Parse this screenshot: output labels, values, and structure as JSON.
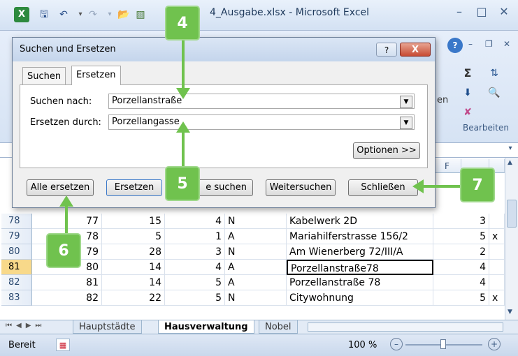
{
  "window": {
    "title": "4_Ausgabe.xlsx - Microsoft Excel"
  },
  "ribbon": {
    "group_label": "Bearbeiten",
    "partial_label": "en"
  },
  "columns": {
    "f_header": "F"
  },
  "sheet_rows": [
    {
      "row": "78",
      "b": "77",
      "c": "15",
      "d": "4",
      "e": "N",
      "f": "Kabelwerk 2D",
      "g": "3",
      "h": "",
      "active": false
    },
    {
      "row": "79",
      "b": "78",
      "c": "5",
      "d": "1",
      "e": "A",
      "f": "Mariahilferstrasse 156/2",
      "g": "5",
      "h": "x",
      "active": false
    },
    {
      "row": "80",
      "b": "79",
      "c": "28",
      "d": "3",
      "e": "N",
      "f": "Am Wienerberg 72/III/A",
      "g": "2",
      "h": "",
      "active": false
    },
    {
      "row": "81",
      "b": "80",
      "c": "14",
      "d": "4",
      "e": "A",
      "f": "Porzellanstraße78",
      "g": "4",
      "h": "",
      "active": true
    },
    {
      "row": "82",
      "b": "81",
      "c": "14",
      "d": "5",
      "e": "A",
      "f": "Porzellanstraße 78",
      "g": "4",
      "h": "",
      "active": false
    },
    {
      "row": "83",
      "b": "82",
      "c": "22",
      "d": "5",
      "e": "N",
      "f": "Citywohnung",
      "g": "5",
      "h": "x",
      "active": false
    }
  ],
  "sheet_tabs": [
    {
      "label": "Hauptstädte",
      "active": false
    },
    {
      "label": "Hausverwaltung",
      "active": true
    },
    {
      "label": "Nobel",
      "active": false
    }
  ],
  "statusbar": {
    "status": "Bereit",
    "zoom": "100 %"
  },
  "dialog": {
    "title": "Suchen und Ersetzen",
    "help_label": "?",
    "close_label": "X",
    "tabs": [
      {
        "label": "Suchen",
        "active": false
      },
      {
        "label": "Ersetzen",
        "active": true
      }
    ],
    "find_label": "Suchen nach:",
    "find_value": "Porzellanstraße",
    "replace_label": "Ersetzen durch:",
    "replace_value": "Porzellangasse",
    "options_label": "Optionen >>",
    "buttons": {
      "replace_all": "Alle ersetzen",
      "replace": "Ersetzen",
      "find_all": "e suchen",
      "find_next": "Weitersuchen",
      "close": "Schließen"
    }
  },
  "callouts": [
    {
      "number": "4"
    },
    {
      "number": "5"
    },
    {
      "number": "6"
    },
    {
      "number": "7"
    }
  ],
  "colors": {
    "callout_green": "#70c24e",
    "active_row_header": "#f8d98a"
  }
}
